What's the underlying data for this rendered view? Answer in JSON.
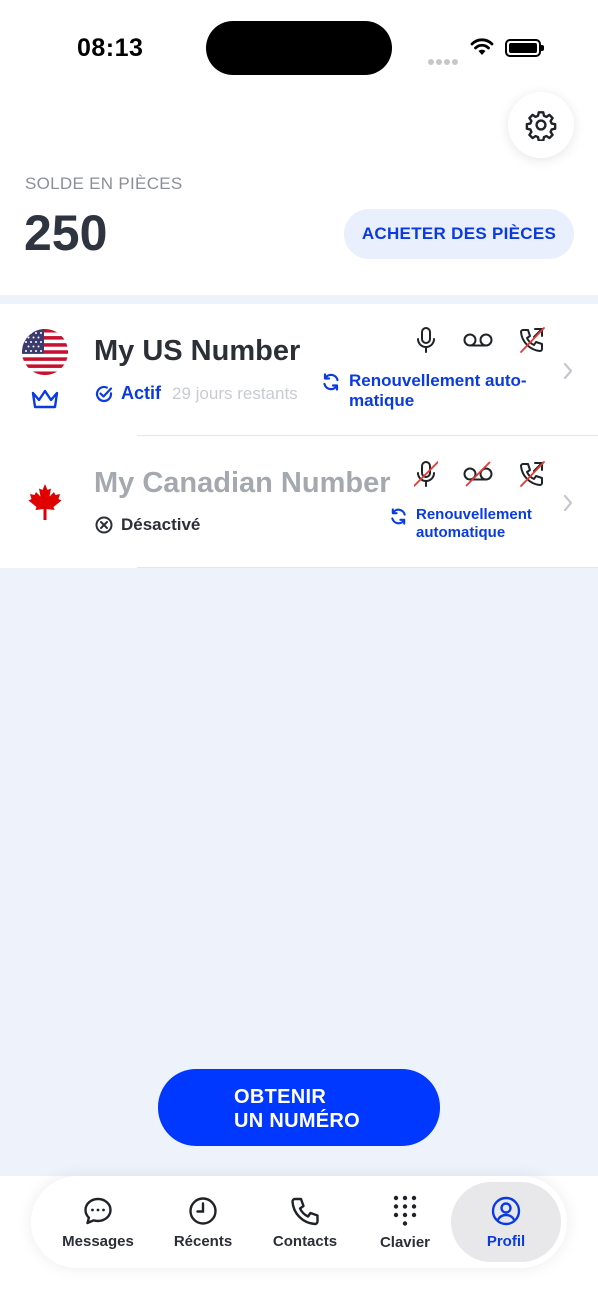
{
  "status_bar": {
    "time": "08:13"
  },
  "header": {
    "balance_label": "SOLDE EN PIÈCES",
    "balance_value": "250",
    "buy_button": "ACHETER DES PIÈCES"
  },
  "numbers": [
    {
      "name": "My US Number",
      "status": "Actif",
      "days_left": "29 jours restants",
      "renewal_line1": "Renouvellement auto-",
      "renewal_line2": "matique",
      "flag": "us-flag",
      "badge": "crown-icon",
      "features": {
        "microphone": true,
        "voicemail": true,
        "call_forwarding": false
      }
    },
    {
      "name": "My Canadian Number",
      "status": "Désactivé",
      "renewal_line1": "Renouvellement",
      "renewal_line2": "automatique",
      "flag": "canada-flag",
      "features": {
        "microphone": false,
        "voicemail": false,
        "call_forwarding": false
      }
    }
  ],
  "cta": {
    "line1": "OBTENIR",
    "line2": "UN NUMÉRO"
  },
  "tabs": [
    {
      "label": "Messages",
      "icon": "chat-bubble-icon"
    },
    {
      "label": "Récents",
      "icon": "clock-icon"
    },
    {
      "label": "Contacts",
      "icon": "phone-icon"
    },
    {
      "label": "Clavier",
      "icon": "keypad-icon"
    },
    {
      "label": "Profil",
      "icon": "profile-icon",
      "active": true
    }
  ],
  "colors": {
    "accent": "#0A3BE0",
    "cta": "#0038FF",
    "background": "#EEF2FB",
    "disabled_text": "#A4A8AF",
    "strike": "#E53935"
  }
}
